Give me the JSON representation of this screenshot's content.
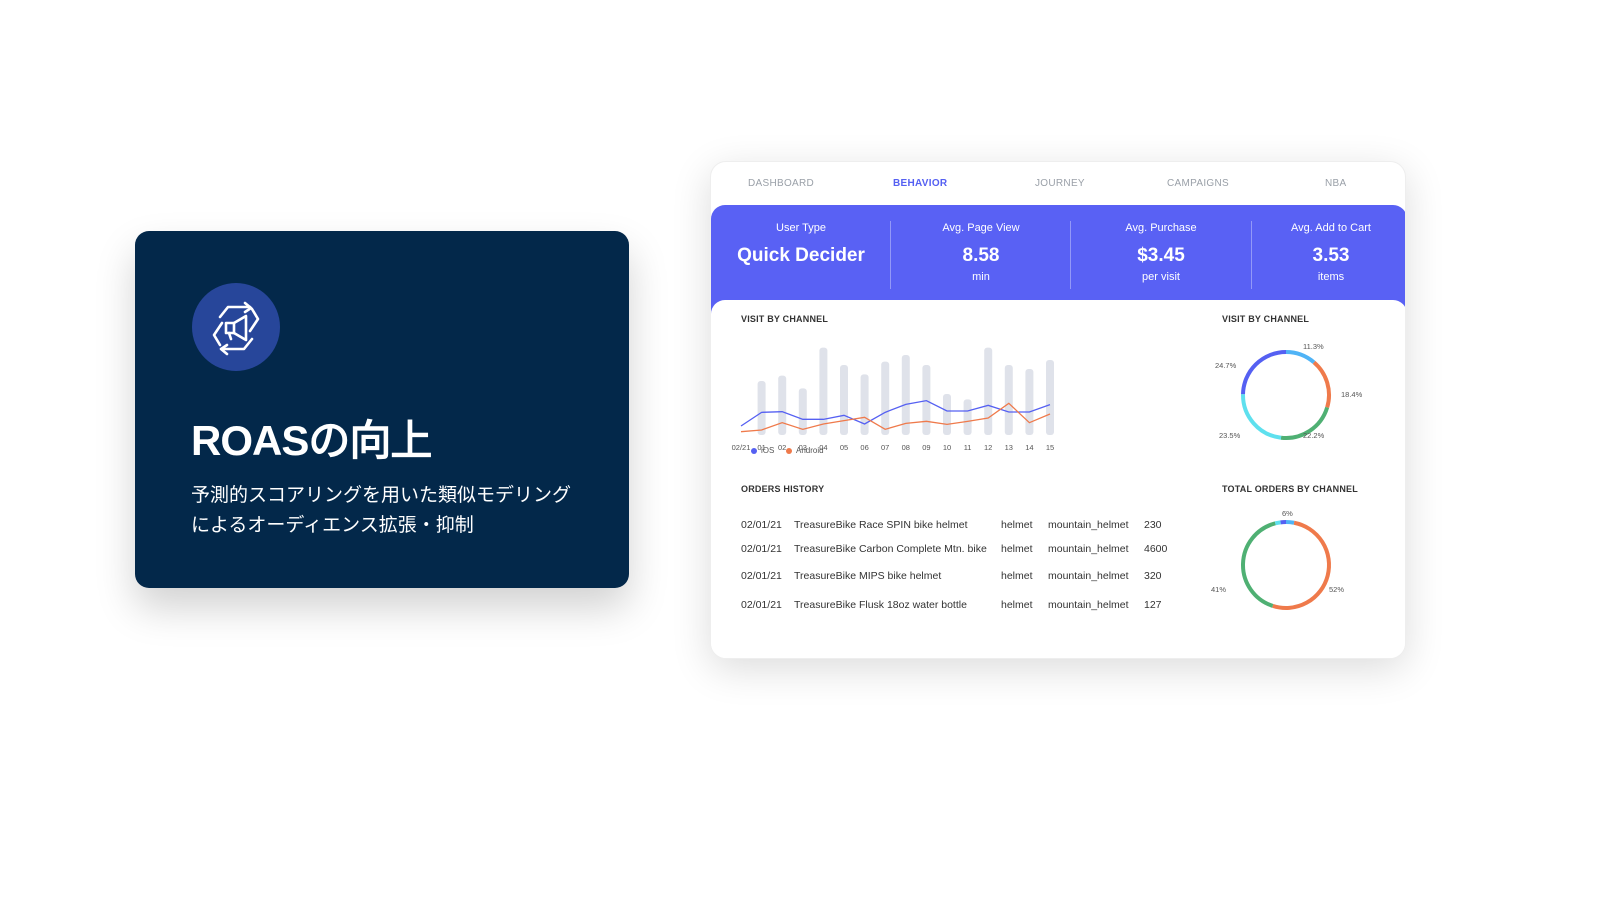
{
  "card": {
    "title": "ROASの向上",
    "description_line1": "予測的スコアリングを用いた類似モデリング",
    "description_line2": "によるオーディエンス拡張・抑制",
    "icon": "megaphone-cycle-icon",
    "background": "#03284a"
  },
  "tabs": [
    {
      "label": "DASHBOARD"
    },
    {
      "label": "BEHAVIOR",
      "active": true
    },
    {
      "label": "JOURNEY"
    },
    {
      "label": "CAMPAIGNS"
    },
    {
      "label": "NBA"
    }
  ],
  "stats": [
    {
      "label": "User Type",
      "value": "Quick Decider",
      "unit": ""
    },
    {
      "label": "Avg. Page View",
      "value": "8.58",
      "unit": "min"
    },
    {
      "label": "Avg. Purchase",
      "value": "$3.45",
      "unit": "per visit"
    },
    {
      "label": "Avg. Add to Cart",
      "value": "3.53",
      "unit": "items"
    }
  ],
  "accent": "#5961f4",
  "visit_chart": {
    "title": "VISIT BY CHANNEL",
    "categories": [
      "02/21",
      "01",
      "02",
      "03",
      "04",
      "05",
      "06",
      "07",
      "08",
      "09",
      "10",
      "11",
      "12",
      "13",
      "14",
      "15"
    ],
    "bars": [
      null,
      162,
      178,
      140,
      262,
      210,
      182,
      220,
      240,
      210,
      123,
      107,
      262,
      210,
      198,
      225
    ],
    "series": [
      {
        "name": "iOS",
        "color": "#5560f2",
        "values": [
          27,
          68,
          70,
          47,
          47,
          59,
          33,
          68,
          92,
          103,
          72,
          72,
          89,
          69,
          69,
          91
        ]
      },
      {
        "name": "Android",
        "color": "#ef7a4b",
        "values": [
          10,
          15,
          37,
          17,
          33,
          43,
          53,
          17,
          35,
          41,
          32,
          41,
          51,
          95,
          37,
          63
        ]
      }
    ],
    "ylim": [
      0,
      270
    ]
  },
  "donut1": {
    "title": "VISIT BY CHANNEL",
    "segments": [
      {
        "label": "11.3%",
        "value": 11.3,
        "color": "#4fb3f6"
      },
      {
        "label": "18.4%",
        "value": 18.4,
        "color": "#ef7a4b"
      },
      {
        "label": "22.2%",
        "value": 22.2,
        "color": "#4fb073"
      },
      {
        "label": "23.5%",
        "value": 23.5,
        "color": "#5ee0ee"
      },
      {
        "label": "24.7%",
        "value": 24.7,
        "color": "#5560f2"
      }
    ]
  },
  "donut2": {
    "title": "TOTAL ORDERS BY CHANNEL",
    "labels": [
      "6%",
      "52%",
      "41%"
    ],
    "segments": [
      {
        "value": 3,
        "color": "#4fb3f6"
      },
      {
        "value": 52,
        "color": "#ef7a4b"
      },
      {
        "value": 41,
        "color": "#4fb073"
      },
      {
        "value": 2,
        "color": "#5ee0ee"
      },
      {
        "value": 2,
        "color": "#5560f2"
      }
    ]
  },
  "orders": {
    "title": "ORDERS HISTORY",
    "rows": [
      [
        "02/01/21",
        "TreasureBike Race SPIN bike helmet",
        "helmet",
        "mountain_helmet",
        "230"
      ],
      [
        "02/01/21",
        "TreasureBike Carbon Complete Mtn. bike",
        "helmet",
        "mountain_helmet",
        "4600"
      ],
      [
        "02/01/21",
        "TreasureBike MIPS bike helmet",
        "helmet",
        "mountain_helmet",
        "320"
      ],
      [
        "02/01/21",
        "TreasureBike Flusk 18oz water bottle",
        "helmet",
        "mountain_helmet",
        "127"
      ]
    ]
  }
}
